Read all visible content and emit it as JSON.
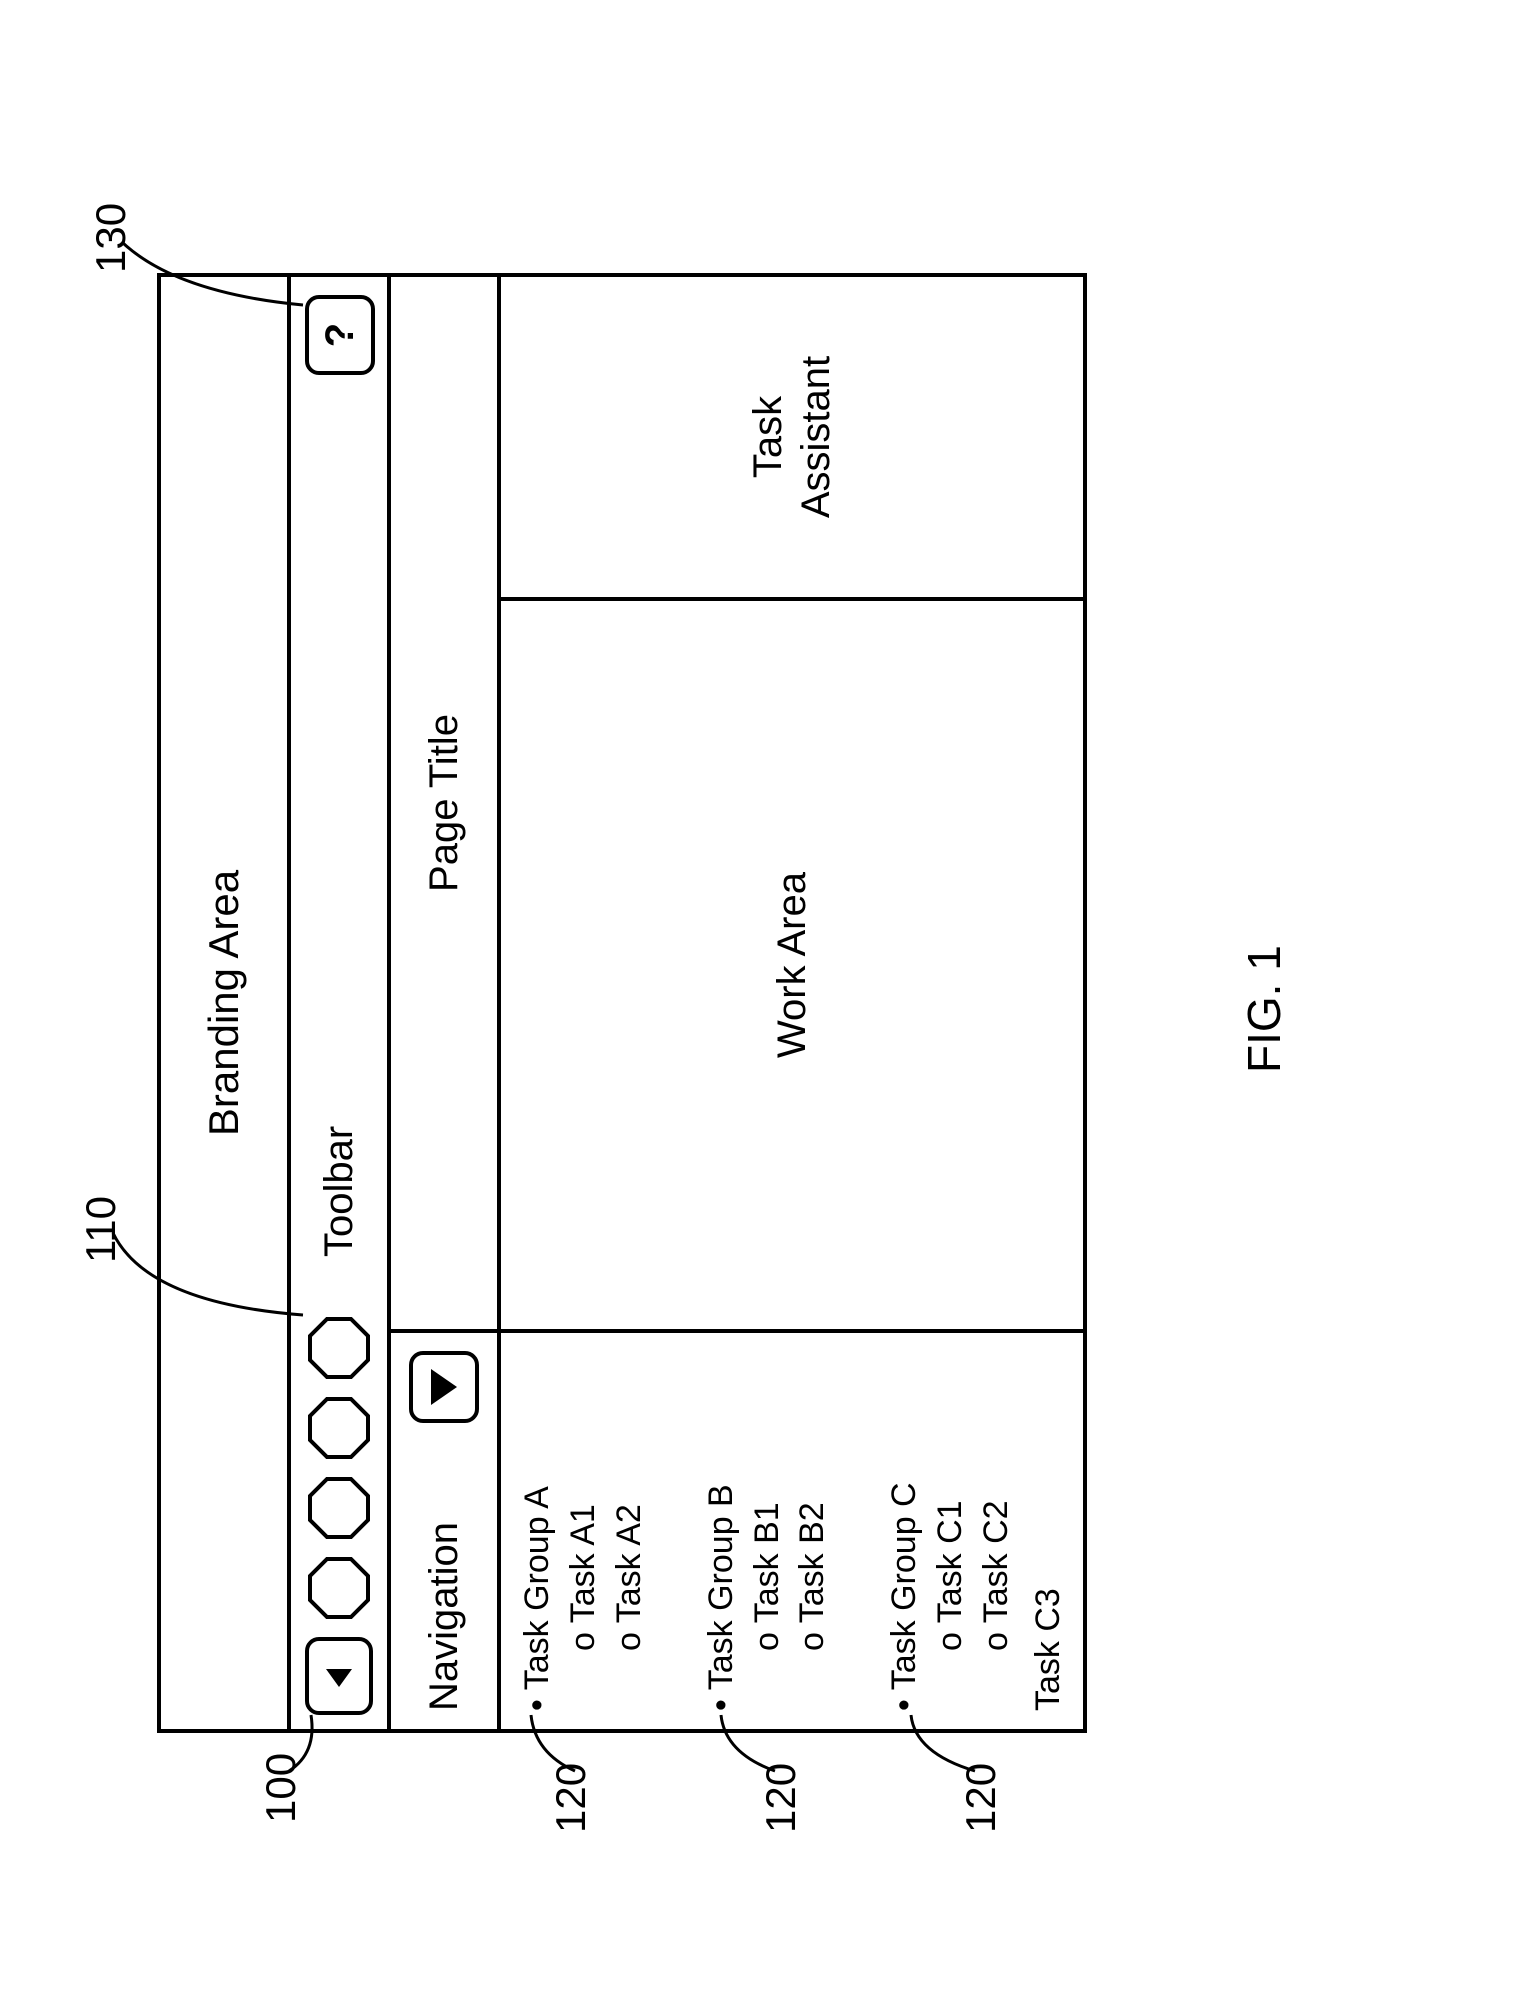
{
  "figure_label": "FIG. 1",
  "callouts": {
    "c100": "100",
    "c110": "110",
    "c120a": "120",
    "c120b": "120",
    "c120c": "120",
    "c130": "130"
  },
  "branding_label": "Branding Area",
  "toolbar_label": "Toolbar",
  "help_label": "?",
  "nav_header": "Navigation",
  "page_title": "Page Title",
  "work_area_label": "Work Area",
  "task_assistant_label": "Task\nAssistant",
  "nav": {
    "groups": [
      {
        "title": "Task Group A",
        "tasks": [
          "Task A1",
          "Task A2"
        ]
      },
      {
        "title": "Task Group B",
        "tasks": [
          "Task B1",
          "Task B2"
        ]
      },
      {
        "title": "Task Group C",
        "tasks": [
          "Task C1",
          "Task C2"
        ]
      }
    ],
    "extra": "Task C3"
  }
}
